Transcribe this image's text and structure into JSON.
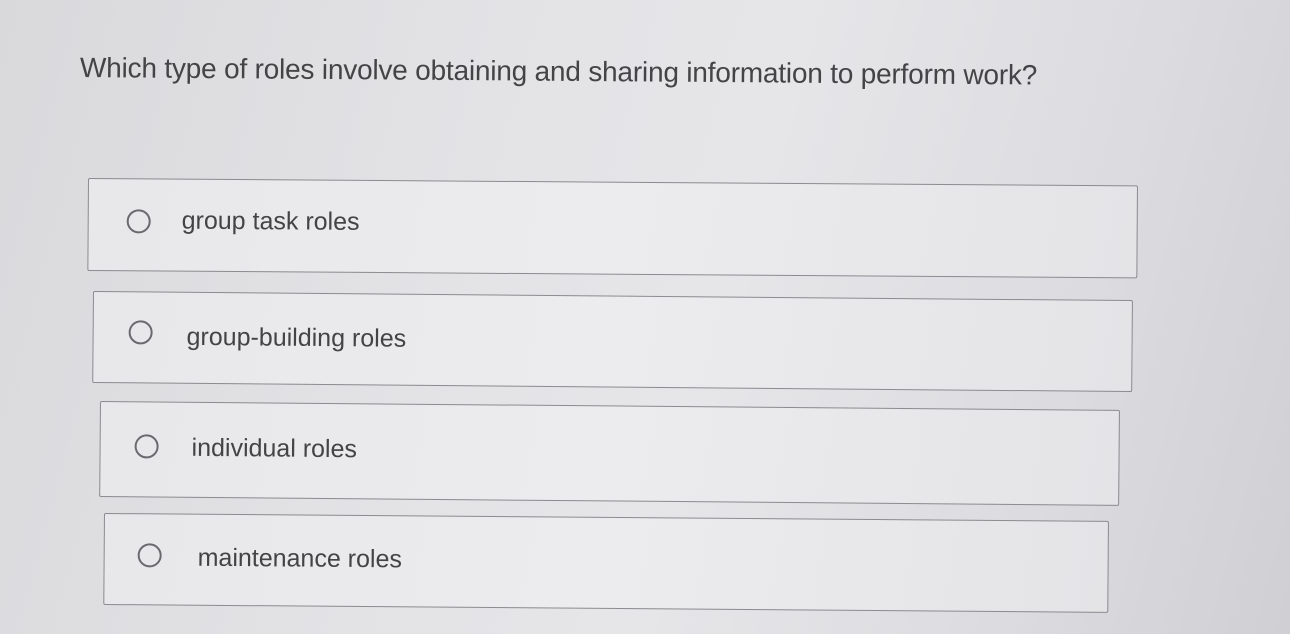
{
  "question": {
    "text": "Which type of roles involve obtaining and sharing information to perform work?"
  },
  "options": [
    {
      "label": "group task roles",
      "selected": false
    },
    {
      "label": "group-building roles",
      "selected": false
    },
    {
      "label": "individual roles",
      "selected": false
    },
    {
      "label": "maintenance roles",
      "selected": false
    }
  ],
  "colors": {
    "background": "#e3e3e6",
    "text": "#444446",
    "border": "#8c8c90",
    "radio": "#6a6a6e"
  }
}
